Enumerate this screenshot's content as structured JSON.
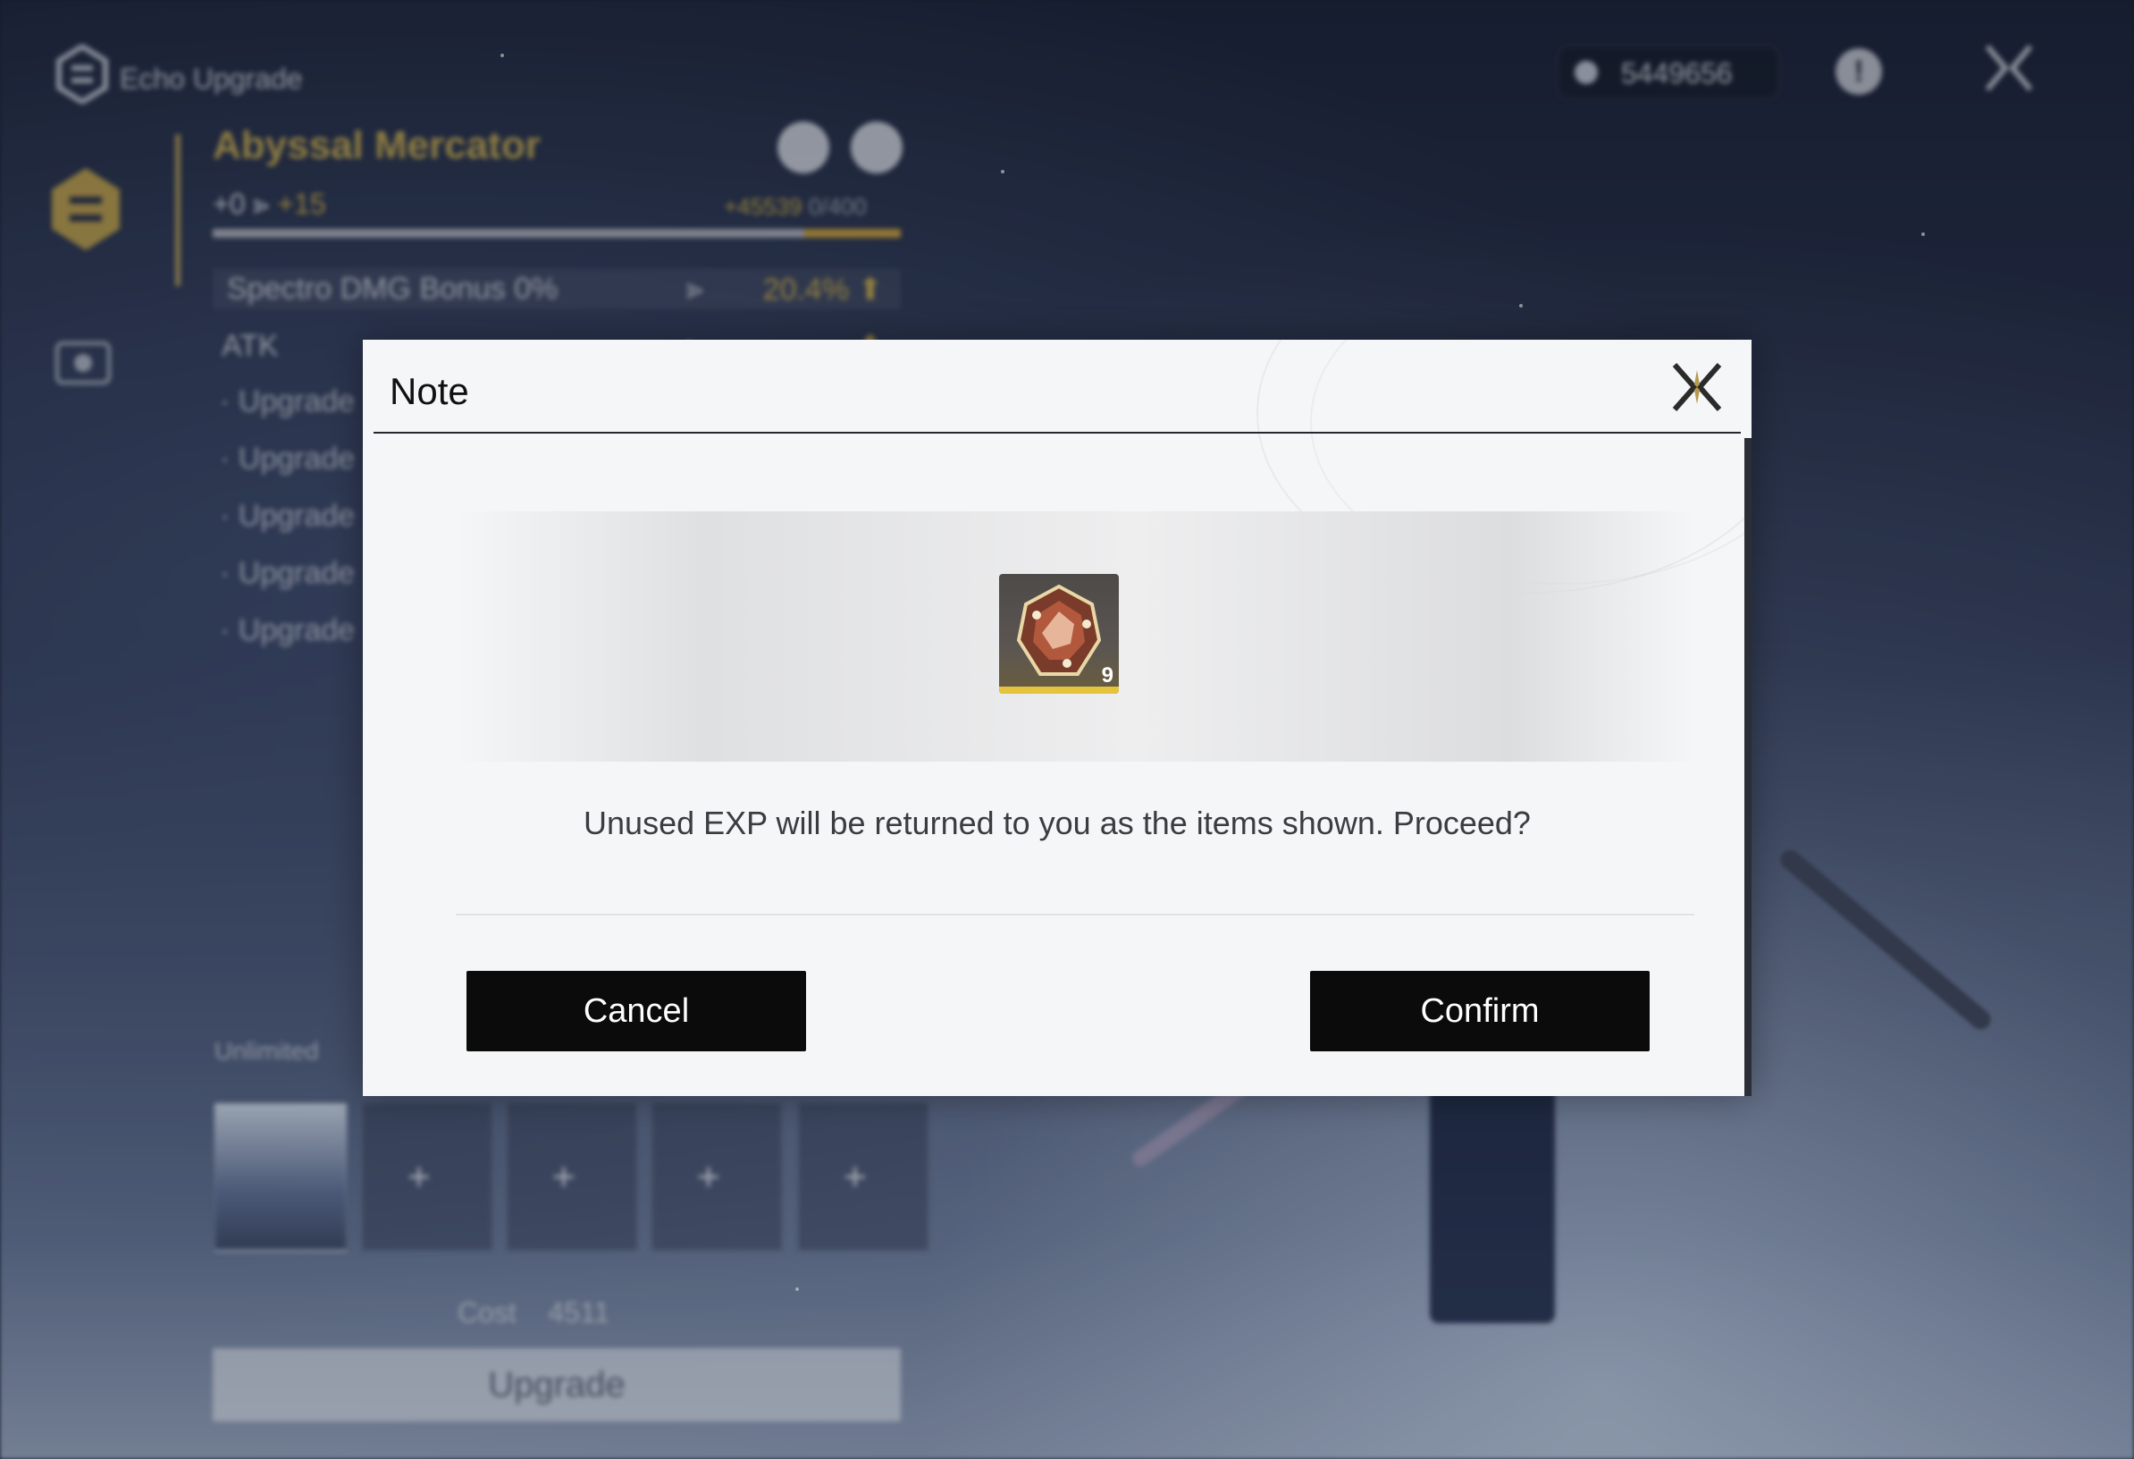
{
  "background": {
    "header_title": "Echo Upgrade",
    "currency_value": "5449656",
    "info_label": "!",
    "echo": {
      "name": "Abyssal Mercator",
      "level_from": "+0",
      "level_arrow": "⪢",
      "level_to": "+15",
      "exp_gain": "+45539",
      "exp_total": "0/400",
      "main_stat": {
        "label": "Spectro DMG Bonus 0%",
        "arrow": "⪢",
        "value": "20.4% ⬆"
      },
      "sub_stat": {
        "label": "ATK",
        "arrow": "⪢",
        "value": "⬆"
      },
      "upgrade_lines": [
        "· Upgrade",
        "· Upgrade",
        "· Upgrade",
        "· Upgrade",
        "· Upgrade"
      ]
    },
    "tune_label": "Unlimited",
    "slot_plus": "+",
    "cost_label": "Cost",
    "cost_value": "4511",
    "upgrade_button": "Upgrade"
  },
  "dialog": {
    "title": "Note",
    "item": {
      "icon": "exp-crystal-icon",
      "quantity": "9"
    },
    "message": "Unused EXP will be returned to you as the items shown. Proceed?",
    "cancel_label": "Cancel",
    "confirm_label": "Confirm"
  },
  "colors": {
    "accent_gold": "#d9b94d",
    "button_dark": "#0b0b0b",
    "dialog_bg": "#f5f6f7"
  }
}
